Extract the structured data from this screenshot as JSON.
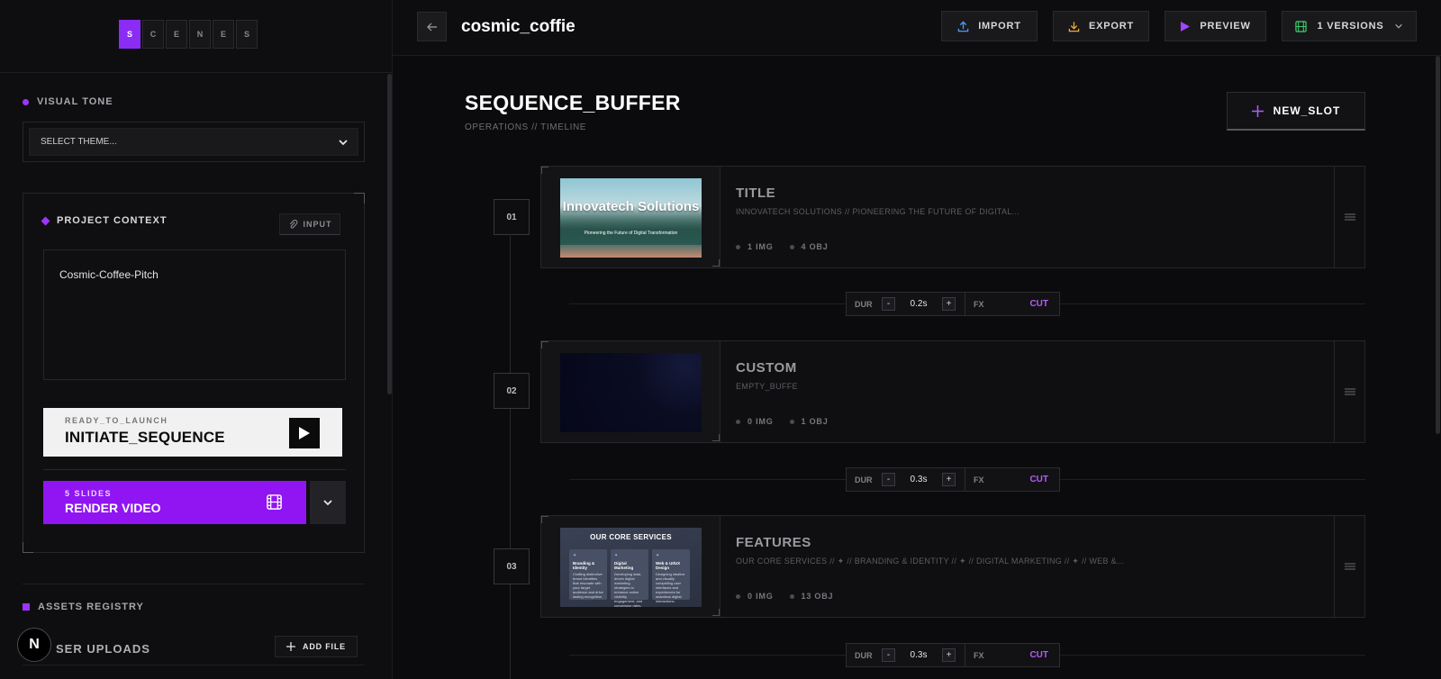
{
  "logo_letters": [
    "S",
    "C",
    "E",
    "N",
    "E",
    "S"
  ],
  "sidebar": {
    "visual_tone_label": "VISUAL TONE",
    "theme_select": {
      "value": "SELECT THEME..."
    },
    "project_context": {
      "label": "PROJECT CONTEXT",
      "input_button": "INPUT",
      "text": "Cosmic-Coffee-Pitch"
    },
    "launch": {
      "sub": "READY_TO_LAUNCH",
      "main": "INITIATE_SEQUENCE"
    },
    "render": {
      "sub": "5 SLIDES",
      "main": "RENDER VIDEO"
    },
    "assets_label": "ASSETS REGISTRY",
    "uploads_label": "SER UPLOADS",
    "add_file_label": "ADD FILE",
    "badge": "N"
  },
  "topbar": {
    "project_title": "cosmic_coffie",
    "import_label": "IMPORT",
    "export_label": "EXPORT",
    "preview_label": "PREVIEW",
    "versions_label": "1 VERSIONS"
  },
  "sequence": {
    "title": "SEQUENCE_BUFFER",
    "subtitle": "OPERATIONS // TIMELINE",
    "new_slot_label": "NEW_SLOT"
  },
  "slots": [
    {
      "num": "01",
      "title": "TITLE",
      "desc": "INNOVATECH SOLUTIONS // PIONEERING THE FUTURE OF DIGITAL...",
      "img": "1 IMG",
      "obj": "4 OBJ",
      "thumb_title": "Innovatech Solutions",
      "thumb_sub": "Pioneering the Future of Digital Transformation"
    },
    {
      "num": "02",
      "title": "CUSTOM",
      "desc": "EMPTY_BUFFE",
      "img": "0 IMG",
      "obj": "1 OBJ"
    },
    {
      "num": "03",
      "title": "FEATURES",
      "desc": "OUR CORE SERVICES // ✦ // BRANDING & IDENTITY // ✦ // DIGITAL MARKETING // ✦ // WEB &...",
      "img": "0 IMG",
      "obj": "13 OBJ",
      "thumb_title": "OUR CORE SERVICES",
      "thumb_cards": [
        {
          "icon": "✦",
          "title": "Branding & Identity",
          "text": "Crafting distinctive brand identities that resonate with your target audience and drive lasting recognition."
        },
        {
          "icon": "✦",
          "title": "Digital Marketing",
          "text": "Developing data-driven digital marketing strategies to enhance online visibility, engagement, and conversion rates."
        },
        {
          "icon": "✦",
          "title": "Web & UI/UX Design",
          "text": "Designing intuitive and visually compelling user interfaces and experiences for seamless digital interactions."
        }
      ]
    }
  ],
  "transitions": [
    {
      "dur_label": "DUR",
      "minus": "-",
      "value": "0.2s",
      "plus": "+",
      "fx_label": "FX",
      "effect": "CUT"
    },
    {
      "dur_label": "DUR",
      "minus": "-",
      "value": "0.3s",
      "plus": "+",
      "fx_label": "FX",
      "effect": "CUT"
    },
    {
      "dur_label": "DUR",
      "minus": "-",
      "value": "0.3s",
      "plus": "+",
      "fx_label": "FX",
      "effect": "CUT"
    }
  ],
  "colors": {
    "accent": "#9015f2",
    "accent_text": "#b45cff",
    "background": "#0b0b0d"
  }
}
